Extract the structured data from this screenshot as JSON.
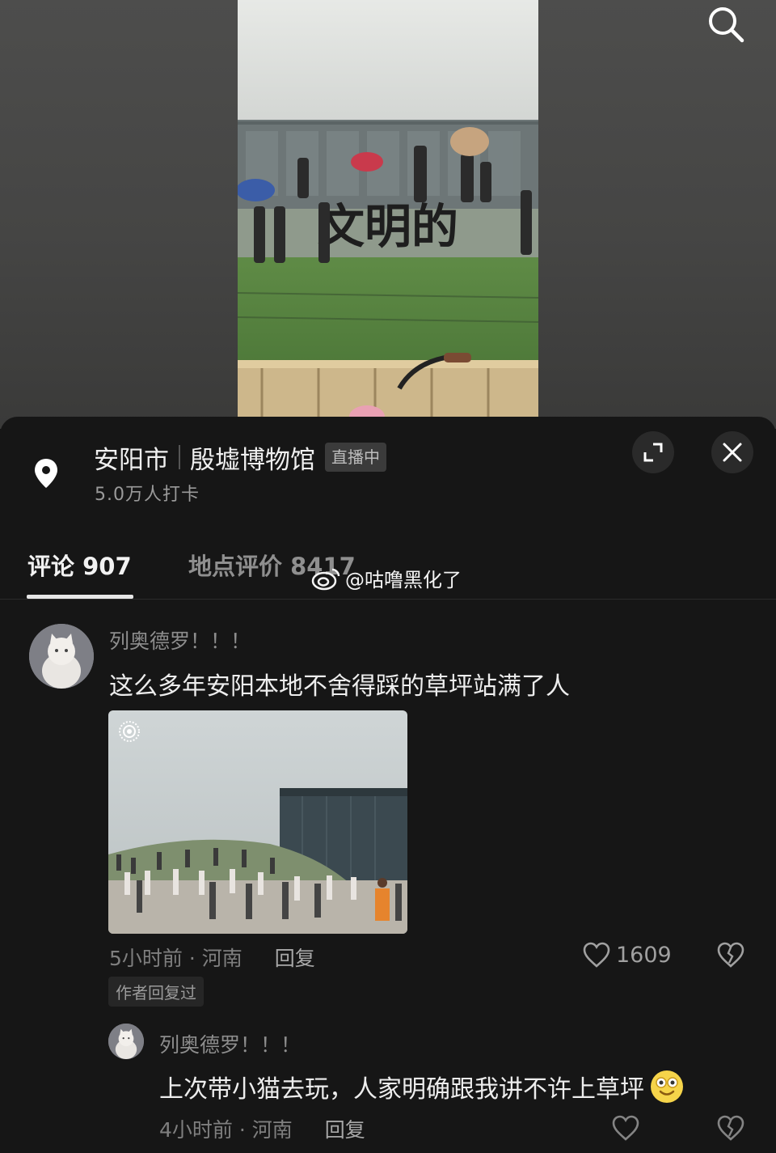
{
  "location": {
    "city": "安阳市",
    "name": "殷墟博物馆",
    "live_badge": "直播中",
    "checkins": "5.0万人打卡"
  },
  "tabs": [
    {
      "label": "评论 907",
      "active": true
    },
    {
      "label": "地点评价 8417",
      "active": false
    }
  ],
  "watermark": "@咕噜黑化了",
  "video_sign_text": "文明的",
  "comment": {
    "username": "列奥德罗！！！",
    "text": "这么多年安阳本地不舍得踩的草坪站满了人",
    "time_region": "5小时前 · 河南",
    "reply_label": "回复",
    "likes": "1609",
    "author_tag": "作者回复过"
  },
  "reply": {
    "username": "列奥德罗！！！",
    "text": "上次带小猫去玩，人家明确跟我讲不许上草坪",
    "time_region": "4小时前 · 河南",
    "reply_label": "回复"
  },
  "icons": [
    "search-icon",
    "location-pin-icon",
    "expand-icon",
    "close-icon",
    "weibo-icon",
    "heart-icon",
    "broken-heart-icon",
    "smile-emoji-icon",
    "live-photo-icon"
  ]
}
